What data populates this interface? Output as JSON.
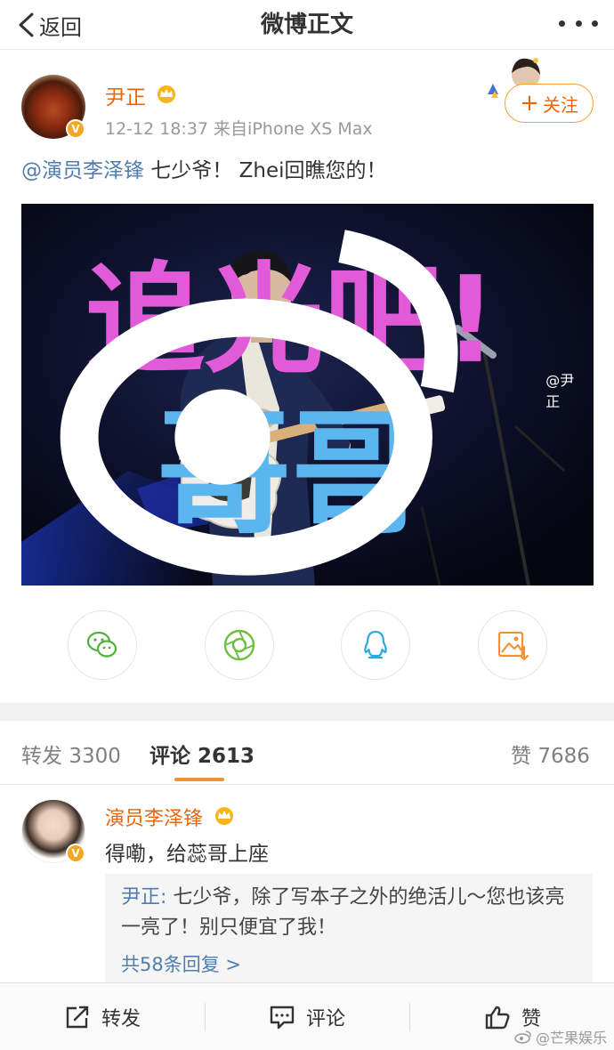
{
  "nav": {
    "back_label": "返回",
    "title": "微博正文"
  },
  "post": {
    "author": "尹正",
    "meta": "12-12 18:37  来自iPhone XS Max",
    "follow_label": "关注",
    "mention": "@演员李泽锋",
    "text": " 七少爷！ Zhei回瞧您的！",
    "photo_watermark": "@尹正",
    "show_logo": "追光吧!哥哥",
    "show_logo_line1": "追光吧!",
    "show_logo_line2": "哥哥"
  },
  "share": {
    "items": [
      "wechat-icon",
      "moments-icon",
      "qq-icon",
      "save-image-icon"
    ]
  },
  "tabs": {
    "repost_label": "转发",
    "repost_count": "3300",
    "comment_label": "评论",
    "comment_count": "2613",
    "like_label": "赞",
    "like_count": "7686"
  },
  "comment": {
    "author": "演员李泽锋",
    "text": "得嘞，给蕊哥上座",
    "reply_author": "尹正:",
    "reply_text": " 七少爷，除了写本子之外的绝活儿～您也该亮一亮了！别只便宜了我！",
    "reply_more": "共58条回复 >"
  },
  "toolbar": {
    "repost_label": "转发",
    "comment_label": "评论",
    "like_label": "赞",
    "source_watermark": "@芒果娱乐"
  },
  "colors": {
    "accent_orange": "#e8660d",
    "link_blue": "#507daf",
    "tab_underline": "#f09236"
  }
}
